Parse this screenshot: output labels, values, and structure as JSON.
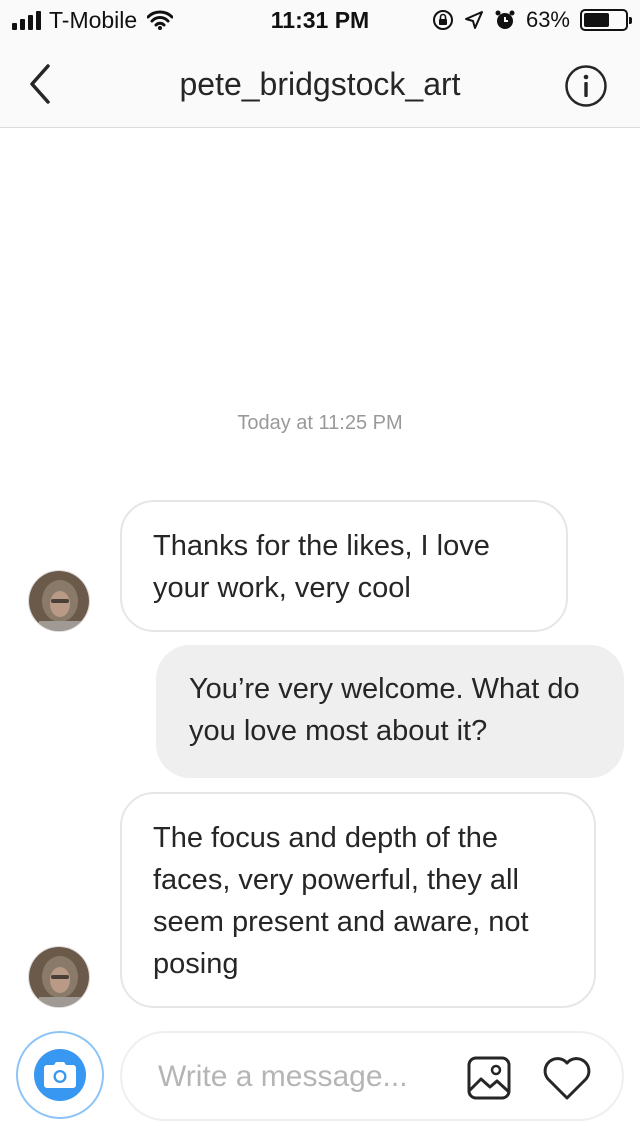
{
  "status_bar": {
    "carrier": "T-Mobile",
    "time": "11:31 PM",
    "battery_percent": "63%",
    "battery_level": 0.63
  },
  "header": {
    "title": "pete_bridgstock_art",
    "back_icon": "chevron-left-icon",
    "info_icon": "info-icon"
  },
  "conversation": {
    "timestamp": "Today at 11:25 PM",
    "messages": [
      {
        "direction": "incoming",
        "text": "Thanks for the likes, I love your work, very cool"
      },
      {
        "direction": "outgoing",
        "text": "You’re very welcome. What do you love most about it?"
      },
      {
        "direction": "incoming",
        "text": "The focus and depth of the faces, very powerful, they all seem present and aware, not posing"
      }
    ]
  },
  "composer": {
    "placeholder": "Write a message...",
    "camera_icon": "camera-icon",
    "gallery_icon": "image-icon",
    "heart_icon": "heart-icon"
  },
  "colors": {
    "accent": "#3897f0",
    "incoming_border": "#e6e6e6",
    "outgoing_bg": "#efefef",
    "text": "#262626",
    "muted": "#999999"
  }
}
